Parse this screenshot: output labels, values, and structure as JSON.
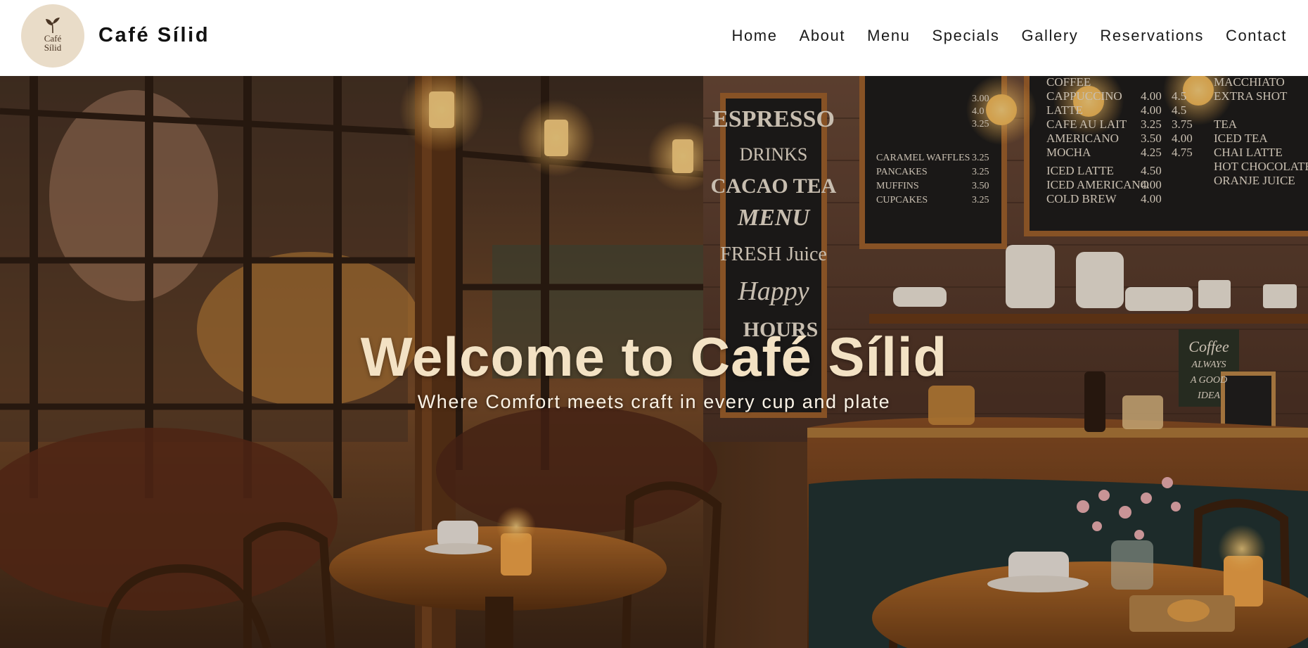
{
  "header": {
    "logo_text_line1": "Café",
    "logo_text_line2": "Sílid",
    "logo_icon": "sprout-icon",
    "brand": "Café Sílid"
  },
  "nav": {
    "items": [
      {
        "label": "Home"
      },
      {
        "label": "About"
      },
      {
        "label": "Menu"
      },
      {
        "label": "Specials"
      },
      {
        "label": "Gallery"
      },
      {
        "label": "Reservations"
      },
      {
        "label": "Contact"
      }
    ]
  },
  "hero": {
    "title": "Welcome to Café Sílid",
    "subtitle": "Where Comfort meets craft in every cup and plate",
    "board_left": [
      "ESPRESSO",
      "DRINKS",
      "CACAO TEA",
      "MENU",
      "FRESH Juice",
      "Happy",
      "HOURS"
    ],
    "board_mid": [
      {
        "item": "CARAMEL WAFFLES",
        "price": "3.25"
      },
      {
        "item": "PANCAKES",
        "price": "3.25"
      },
      {
        "item": "MUFFINS",
        "price": "3.50"
      },
      {
        "item": "CUPCAKES",
        "price": "3.25"
      }
    ],
    "board_mid_top": [
      "3.00",
      "4.0",
      "3.25"
    ],
    "board_right_left": [
      {
        "item": "COFFEE",
        "p1": "",
        "p2": ""
      },
      {
        "item": "CAPPUCCINO",
        "p1": "4.00",
        "p2": "4.5"
      },
      {
        "item": "LATTE",
        "p1": "4.00",
        "p2": "4.5"
      },
      {
        "item": "CAFE AU LAIT",
        "p1": "3.25",
        "p2": "3.75"
      },
      {
        "item": "AMERICANO",
        "p1": "3.50",
        "p2": "4.00"
      },
      {
        "item": "MOCHA",
        "p1": "4.25",
        "p2": "4.75"
      },
      {
        "item": "ICED LATTE",
        "p1": "4.50",
        "p2": ""
      },
      {
        "item": "ICED AMERICANO",
        "p1": "4.00",
        "p2": ""
      },
      {
        "item": "COLD BREW",
        "p1": "4.00",
        "p2": ""
      }
    ],
    "board_right_right": [
      "MACCHIATO",
      "EXTRA SHOT",
      "TEA",
      "ICED TEA",
      "CHAI LATTE",
      "HOT CHOCOLATE",
      "ORANJE JUICE"
    ],
    "sign": [
      "Coffee",
      "ALWAYS",
      "A GOOD",
      "IDEA"
    ]
  },
  "colors": {
    "header_bg": "#ffffff",
    "brand_text": "#111111",
    "logo_bg": "#e9dcc8",
    "hero_title": "#f3e2c4",
    "hero_subtitle": "#fbf3e6"
  }
}
